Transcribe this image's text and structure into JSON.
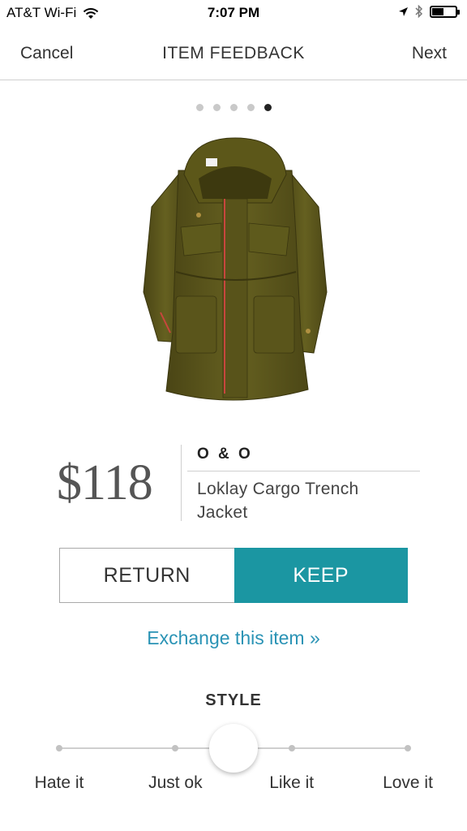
{
  "status_bar": {
    "carrier": "AT&T Wi-Fi",
    "time": "7:07 PM",
    "battery_level": 0.5
  },
  "nav": {
    "cancel_label": "Cancel",
    "title": "ITEM FEEDBACK",
    "next_label": "Next"
  },
  "pager": {
    "total": 5,
    "active_index": 4
  },
  "product": {
    "price": "$118",
    "brand": "O & O",
    "name": "Loklay Cargo Trench Jacket",
    "image_icon": "olive-cargo-trench-jacket"
  },
  "actions": {
    "return_label": "RETURN",
    "keep_label": "KEEP",
    "keep_color": "#1b96a2",
    "exchange_label": "Exchange this item »",
    "exchange_color": "#2a93b5"
  },
  "style_rating": {
    "label": "STYLE",
    "options": [
      "Hate it",
      "Just ok",
      "Like it",
      "Love it"
    ],
    "selected_position": 0.5
  }
}
